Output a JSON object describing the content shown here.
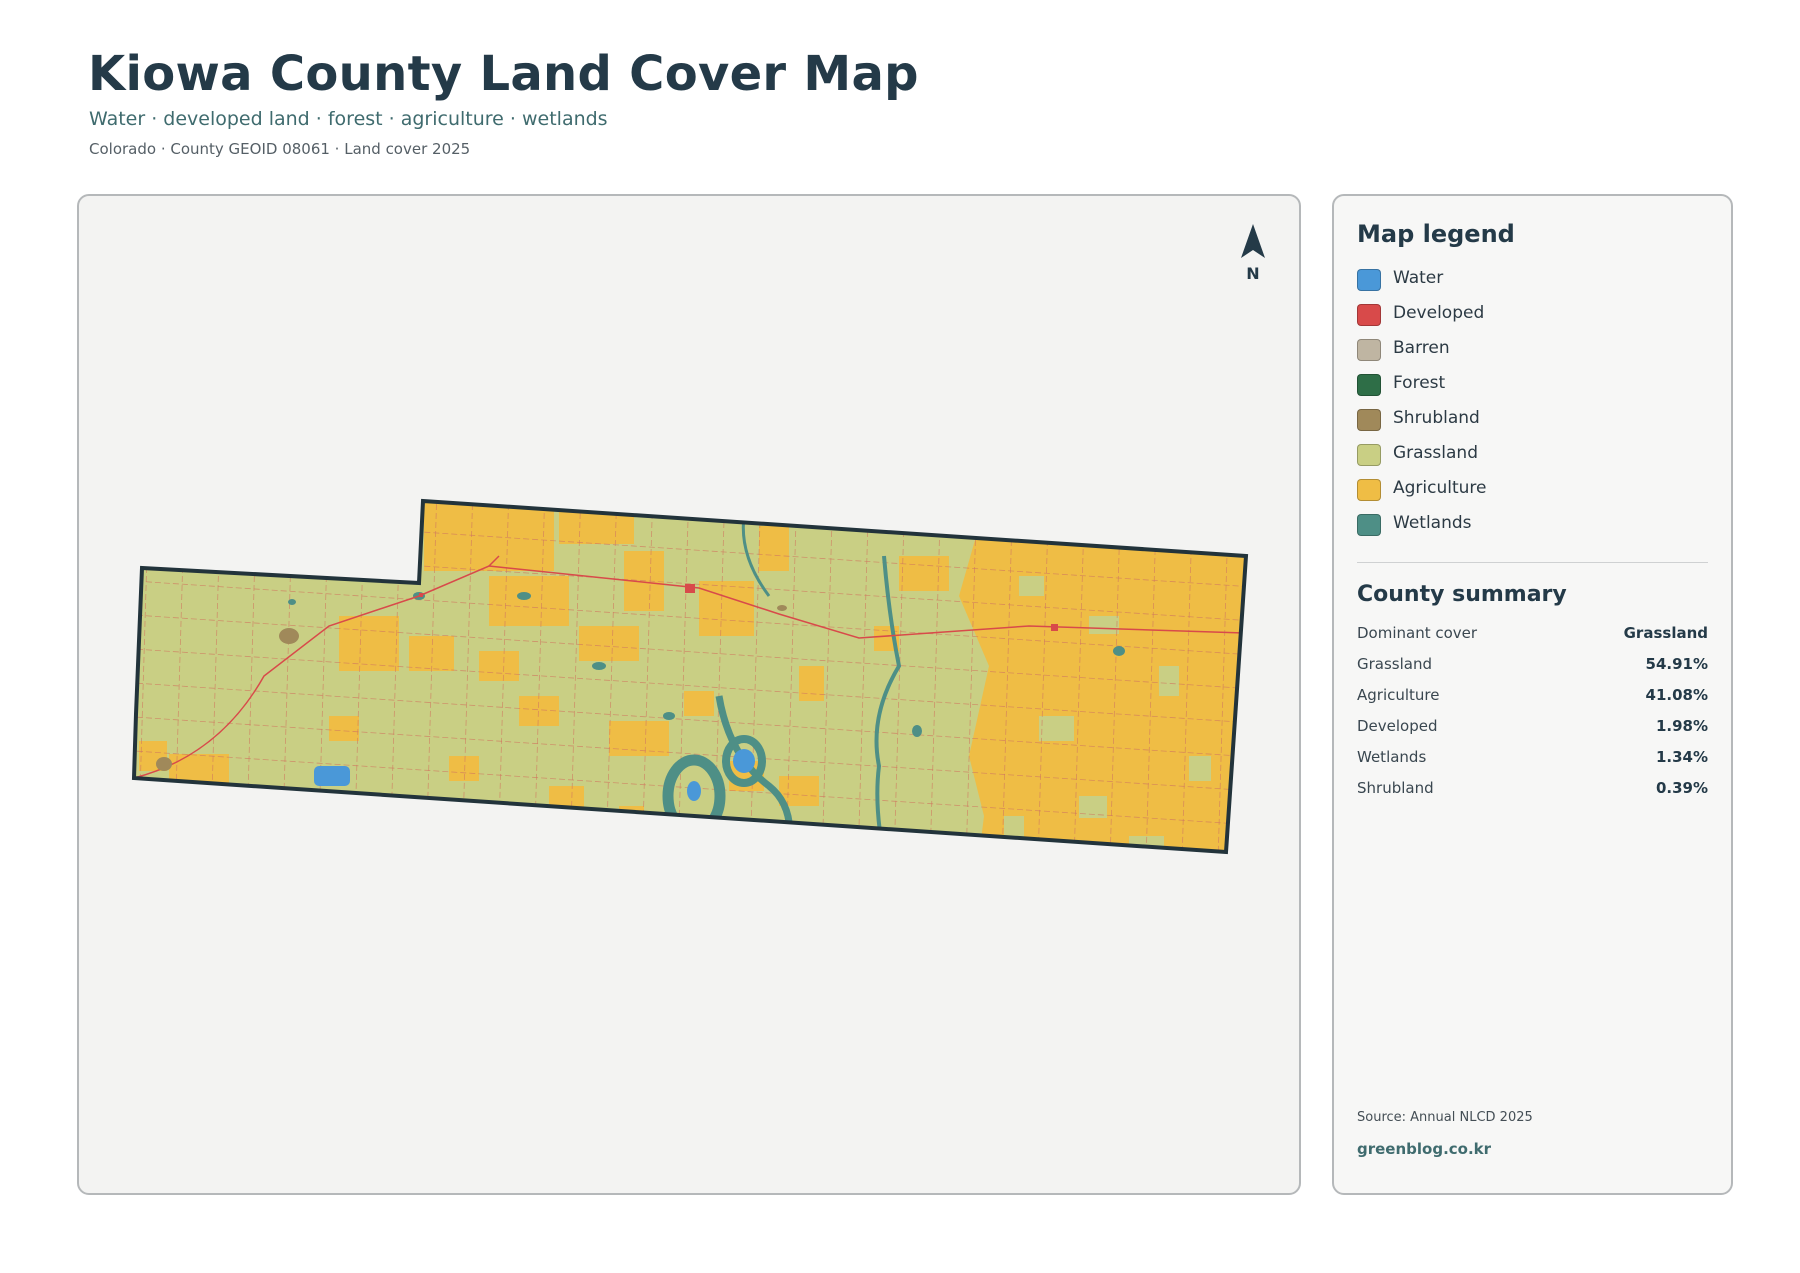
{
  "header": {
    "title": "Kiowa County Land Cover Map",
    "subtitle": "Water · developed land · forest · agriculture · wetlands",
    "meta": "Colorado · County GEOID 08061 · Land cover 2025"
  },
  "map": {
    "north_label": "N",
    "colors": {
      "background": "#f3f3f2",
      "county_outline": "#22333b",
      "grassland": "#c9cf84",
      "agriculture": "#efbd45",
      "water": "#4a98d8",
      "wetlands": "#4e8f86",
      "developed": "#d84a4a",
      "shrubland": "#a0895a",
      "roads": "#d07860"
    }
  },
  "legend": {
    "title": "Map legend",
    "items": [
      {
        "label": "Water",
        "color": "#4a98d8"
      },
      {
        "label": "Developed",
        "color": "#d84a4a"
      },
      {
        "label": "Barren",
        "color": "#bfb5a2"
      },
      {
        "label": "Forest",
        "color": "#2e6e47"
      },
      {
        "label": "Shrubland",
        "color": "#a0895a"
      },
      {
        "label": "Grassland",
        "color": "#c9cf84"
      },
      {
        "label": "Agriculture",
        "color": "#efbd45"
      },
      {
        "label": "Wetlands",
        "color": "#4e8f86"
      }
    ]
  },
  "summary": {
    "title": "County summary",
    "rows": [
      {
        "label": "Dominant cover",
        "value": "Grassland"
      },
      {
        "label": "Grassland",
        "value": "54.91%"
      },
      {
        "label": "Agriculture",
        "value": "41.08%"
      },
      {
        "label": "Developed",
        "value": "1.98%"
      },
      {
        "label": "Wetlands",
        "value": "1.34%"
      },
      {
        "label": "Shrubland",
        "value": "0.39%"
      }
    ]
  },
  "footer": {
    "source": "Source: Annual NLCD 2025",
    "site": "greenblog.co.kr"
  }
}
